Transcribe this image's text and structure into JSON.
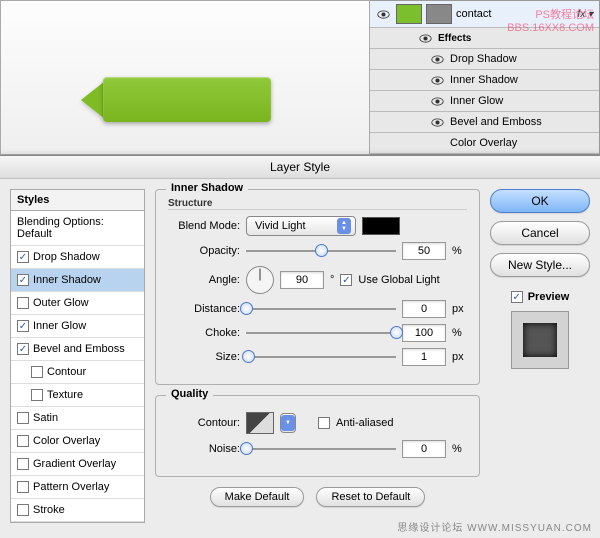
{
  "watermark": {
    "line1": "PS教程论坛",
    "line2": "BBS.16XX8.COM"
  },
  "layers": {
    "layer_name": "contact",
    "effects_label": "Effects",
    "items": [
      "Drop Shadow",
      "Inner Shadow",
      "Inner Glow",
      "Bevel and Emboss",
      "Color Overlay"
    ]
  },
  "dialog": {
    "title": "Layer Style",
    "styles_header": "Styles",
    "blending_opts": "Blending Options: Default",
    "style_list": [
      {
        "label": "Drop Shadow",
        "checked": true
      },
      {
        "label": "Inner Shadow",
        "checked": true,
        "selected": true
      },
      {
        "label": "Outer Glow",
        "checked": false
      },
      {
        "label": "Inner Glow",
        "checked": true
      },
      {
        "label": "Bevel and Emboss",
        "checked": true
      },
      {
        "label": "Contour",
        "checked": false,
        "sub": true
      },
      {
        "label": "Texture",
        "checked": false,
        "sub": true
      },
      {
        "label": "Satin",
        "checked": false
      },
      {
        "label": "Color Overlay",
        "checked": false
      },
      {
        "label": "Gradient Overlay",
        "checked": false
      },
      {
        "label": "Pattern Overlay",
        "checked": false
      },
      {
        "label": "Stroke",
        "checked": false
      }
    ],
    "panel_title": "Inner Shadow",
    "structure_label": "Structure",
    "quality_label": "Quality",
    "blend_mode_label": "Blend Mode:",
    "blend_mode_value": "Vivid Light",
    "opacity_label": "Opacity:",
    "opacity_value": "50",
    "angle_label": "Angle:",
    "angle_value": "90",
    "angle_degree": "°",
    "global_light": "Use Global Light",
    "distance_label": "Distance:",
    "distance_value": "0",
    "choke_label": "Choke:",
    "choke_value": "100",
    "size_label": "Size:",
    "size_value": "1",
    "px": "px",
    "pct": "%",
    "contour_label": "Contour:",
    "antialiased": "Anti-aliased",
    "noise_label": "Noise:",
    "noise_value": "0",
    "make_default": "Make Default",
    "reset_default": "Reset to Default",
    "ok": "OK",
    "cancel": "Cancel",
    "new_style": "New Style...",
    "preview": "Preview"
  },
  "footer": "思缘设计论坛  WWW.MISSYUAN.COM"
}
